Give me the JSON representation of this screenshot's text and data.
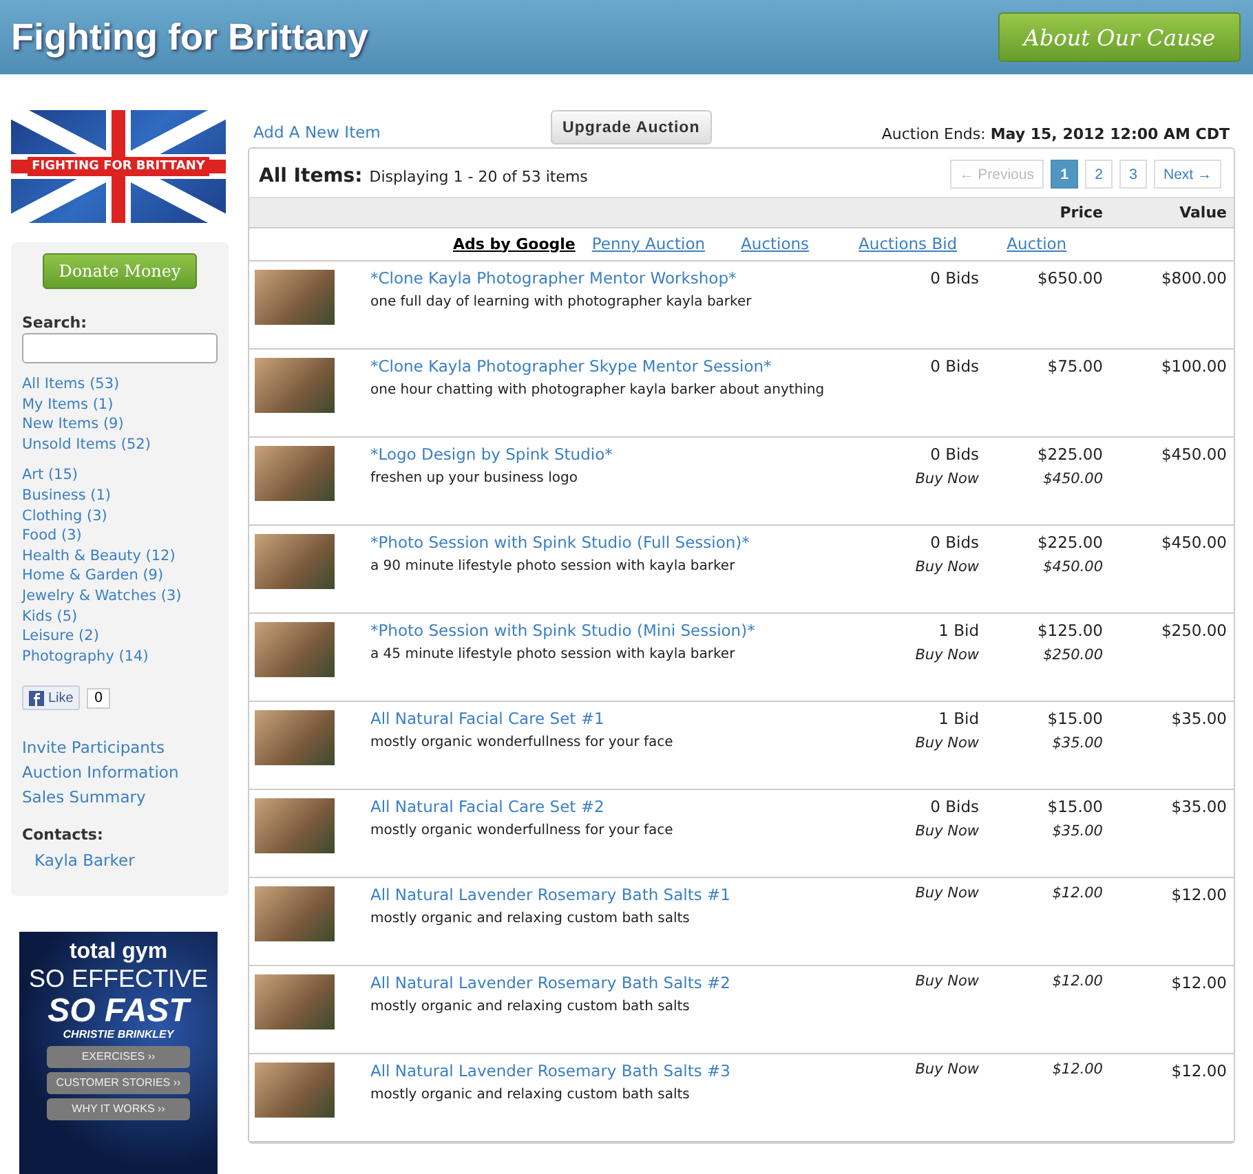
{
  "header": {
    "title": "Fighting for Brittany",
    "cause_button": "About Our Cause"
  },
  "sidebar": {
    "logo_text": "FIGHTING FOR BRITTANY",
    "donate_button": "Donate Money",
    "search_label": "Search:",
    "filters": [
      "All Items (53)",
      "My Items (1)",
      "New Items (9)",
      "Unsold Items (52)"
    ],
    "categories": [
      "Art (15)",
      "Business (1)",
      "Clothing (3)",
      "Food (3)",
      "Health & Beauty (12)",
      "Home & Garden (9)",
      "Jewelry & Watches (3)",
      "Kids (5)",
      "Leisure (2)",
      "Photography (14)"
    ],
    "like": {
      "label": "Like",
      "count": "0"
    },
    "links": [
      "Invite Participants",
      "Auction Information",
      "Sales Summary"
    ],
    "contacts_label": "Contacts:",
    "contacts": [
      "Kayla Barker"
    ],
    "ad": {
      "brand": "total gym",
      "line_1": "SO EFFECTIVE",
      "line_2": "SO FAST",
      "quote_by": "CHRISTIE BRINKLEY",
      "buttons": [
        "EXERCISES ››",
        "CUSTOMER STORIES ››",
        "WHY IT WORKS ››"
      ]
    }
  },
  "toolbar": {
    "add_link": "Add A New Item",
    "upgrade_button": "Upgrade Auction",
    "ends_label": "Auction Ends:",
    "ends_value": "May 15, 2012 12:00 AM CDT"
  },
  "listing": {
    "title": "All Items:",
    "summary": "Displaying 1 - 20 of 53 items",
    "pagination": [
      {
        "label": "← Previous",
        "kind": "nav",
        "disabled": true,
        "selected": false
      },
      {
        "label": "1",
        "kind": "page",
        "disabled": false,
        "selected": true
      },
      {
        "label": "2",
        "kind": "page",
        "disabled": false,
        "selected": false
      },
      {
        "label": "3",
        "kind": "page",
        "disabled": false,
        "selected": false
      },
      {
        "label": "Next →",
        "kind": "nav",
        "disabled": false,
        "selected": false
      }
    ],
    "columns": [
      "Price",
      "Value"
    ],
    "ads_label": "Ads by Google",
    "ad_links": [
      "Penny Auction",
      "Auctions",
      "Auctions Bid",
      "Auction"
    ],
    "items": [
      {
        "title": "*Clone Kayla Photographer Mentor Workshop*",
        "description": "one full day of learning with photographer kayla barker",
        "bids": "0 Bids",
        "price": "$650.00",
        "value": "$800.00"
      },
      {
        "title": "*Clone Kayla Photographer Skype Mentor Session*",
        "description": "one hour chatting with photographer kayla barker about anything",
        "bids": "0 Bids",
        "price": "$75.00",
        "value": "$100.00"
      },
      {
        "title": "*Logo Design by Spink Studio*",
        "description": "freshen up your business logo",
        "bids": "0 Bids",
        "price": "$225.00",
        "buy_now_label": "Buy Now",
        "buy_now_price": "$450.00",
        "value": "$450.00"
      },
      {
        "title": "*Photo Session with Spink Studio (Full Session)*",
        "description": "a 90 minute lifestyle photo session with kayla barker",
        "bids": "0 Bids",
        "price": "$225.00",
        "buy_now_label": "Buy Now",
        "buy_now_price": "$450.00",
        "value": "$450.00"
      },
      {
        "title": "*Photo Session with Spink Studio (Mini Session)*",
        "description": "a 45 minute lifestyle photo session with kayla barker",
        "bids": "1 Bid",
        "price": "$125.00",
        "buy_now_label": "Buy Now",
        "buy_now_price": "$250.00",
        "value": "$250.00"
      },
      {
        "title": "All Natural Facial Care Set #1",
        "description": "mostly organic wonderfullness for your face",
        "bids": "1 Bid",
        "price": "$15.00",
        "buy_now_label": "Buy Now",
        "buy_now_price": "$35.00",
        "value": "$35.00"
      },
      {
        "title": "All Natural Facial Care Set #2",
        "description": "mostly organic wonderfullness for your face",
        "bids": "0 Bids",
        "price": "$15.00",
        "buy_now_label": "Buy Now",
        "buy_now_price": "$35.00",
        "value": "$35.00"
      },
      {
        "title": "All Natural Lavender Rosemary Bath Salts #1",
        "description": "mostly organic and relaxing custom bath salts",
        "buy_now_label": "Buy Now",
        "buy_now_price": "$12.00",
        "value": "$12.00"
      },
      {
        "title": "All Natural Lavender Rosemary Bath Salts #2",
        "description": "mostly organic and relaxing custom bath salts",
        "buy_now_label": "Buy Now",
        "buy_now_price": "$12.00",
        "value": "$12.00"
      },
      {
        "title": "All Natural Lavender Rosemary Bath Salts #3",
        "description": "mostly organic and relaxing custom bath salts",
        "buy_now_label": "Buy Now",
        "buy_now_price": "$12.00",
        "value": "$12.00"
      }
    ]
  }
}
